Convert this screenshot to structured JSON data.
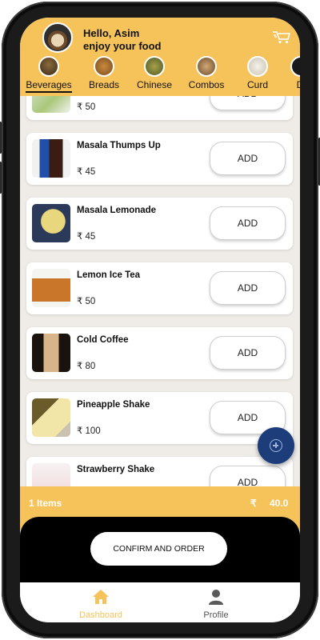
{
  "header": {
    "greeting": "Hello, Asim",
    "subtitle": "enjoy your food",
    "avatar_icon": "food-avatar",
    "cart_icon": "cart-icon"
  },
  "categories": [
    {
      "label": "Beverages",
      "active": true
    },
    {
      "label": "Breads",
      "active": false
    },
    {
      "label": "Chinese",
      "active": false
    },
    {
      "label": "Combos",
      "active": false
    },
    {
      "label": "Curd",
      "active": false
    },
    {
      "label": "D",
      "active": false
    }
  ],
  "products": [
    {
      "name": "",
      "price": "₹ 50",
      "add": "ADD"
    },
    {
      "name": "Masala Thumps Up",
      "price": "₹ 45",
      "add": "ADD"
    },
    {
      "name": "Masala Lemonade",
      "price": "₹ 45",
      "add": "ADD"
    },
    {
      "name": "Lemon Ice Tea",
      "price": "₹ 50",
      "add": "ADD"
    },
    {
      "name": "Cold Coffee",
      "price": "₹ 80",
      "add": "ADD"
    },
    {
      "name": "Pineapple Shake",
      "price": "₹ 100",
      "add": "ADD"
    },
    {
      "name": "Strawberry Shake",
      "price": "",
      "add": "ADD"
    }
  ],
  "summary": {
    "items": "1 Items",
    "currency": "₹",
    "total": "40.0"
  },
  "confirm_label": "CONFIRM AND ORDER",
  "nav": {
    "dashboard": "Dashboard",
    "profile": "Profile"
  },
  "colors": {
    "accent": "#f6c35a",
    "fab": "#1d3d7a",
    "active_nav": "#f6c35a"
  }
}
